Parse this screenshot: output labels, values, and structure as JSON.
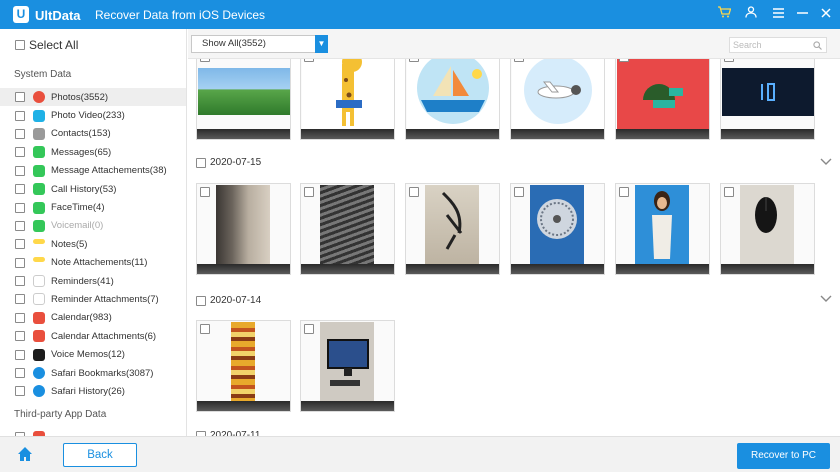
{
  "titlebar": {
    "logo_glyph": "U",
    "app_name": "UltData",
    "subtitle": "Recover Data from iOS Devices",
    "icons": [
      "cart-icon",
      "user-icon",
      "menu-icon",
      "minimize-icon",
      "close-icon"
    ],
    "accent": "#1a8fe0"
  },
  "sidebar": {
    "select_all": "Select All",
    "system_header": "System Data",
    "third_party_header": "Third-party App Data",
    "items": [
      {
        "label": "Photos(3552)",
        "icon": "photos-icon",
        "color": "#e94f3d",
        "checked": false,
        "selected": true,
        "disabled": false
      },
      {
        "label": "Photo Video(233)",
        "icon": "photo-video-icon",
        "color": "#1fb1e6",
        "checked": false,
        "selected": false,
        "disabled": false
      },
      {
        "label": "Contacts(153)",
        "icon": "contacts-icon",
        "color": "#9a9a9a",
        "checked": false,
        "selected": false,
        "disabled": false
      },
      {
        "label": "Messages(65)",
        "icon": "messages-icon",
        "color": "#34c759",
        "checked": false,
        "selected": false,
        "disabled": false
      },
      {
        "label": "Message Attachements(38)",
        "icon": "message-attachments-icon",
        "color": "#34c759",
        "checked": false,
        "selected": false,
        "disabled": false
      },
      {
        "label": "Call History(53)",
        "icon": "call-history-icon",
        "color": "#34c759",
        "checked": false,
        "selected": false,
        "disabled": false
      },
      {
        "label": "FaceTime(4)",
        "icon": "facetime-icon",
        "color": "#34c759",
        "checked": false,
        "selected": false,
        "disabled": false
      },
      {
        "label": "Voicemail(0)",
        "icon": "voicemail-icon",
        "color": "#34c759",
        "checked": false,
        "selected": false,
        "disabled": true
      },
      {
        "label": "Notes(5)",
        "icon": "notes-icon",
        "color": "#ffd84a",
        "checked": false,
        "selected": false,
        "disabled": false
      },
      {
        "label": "Note Attachements(11)",
        "icon": "note-attachments-icon",
        "color": "#ffd84a",
        "checked": false,
        "selected": false,
        "disabled": false
      },
      {
        "label": "Reminders(41)",
        "icon": "reminders-icon",
        "color": "#ffffff",
        "checked": false,
        "selected": false,
        "disabled": false
      },
      {
        "label": "Reminder Attachments(7)",
        "icon": "reminder-attachments-icon",
        "color": "#ffffff",
        "checked": false,
        "selected": false,
        "disabled": false
      },
      {
        "label": "Calendar(983)",
        "icon": "calendar-icon",
        "color": "#e94f3d",
        "checked": false,
        "selected": false,
        "disabled": false
      },
      {
        "label": "Calendar Attachments(6)",
        "icon": "calendar-attachments-icon",
        "color": "#e94f3d",
        "checked": false,
        "selected": false,
        "disabled": false
      },
      {
        "label": "Voice Memos(12)",
        "icon": "voice-memos-icon",
        "color": "#1c1c1c",
        "checked": false,
        "selected": false,
        "disabled": false
      },
      {
        "label": "Safari Bookmarks(3087)",
        "icon": "safari-bookmarks-icon",
        "color": "#1a8fe0",
        "checked": false,
        "selected": false,
        "disabled": false
      },
      {
        "label": "Safari History(26)",
        "icon": "safari-history-icon",
        "color": "#1a8fe0",
        "checked": false,
        "selected": false,
        "disabled": false
      }
    ]
  },
  "toolbar": {
    "filter_value": "Show All(3552)",
    "search_placeholder": "Search"
  },
  "content": {
    "groups": [
      {
        "date": "",
        "photos": [
          "meadow",
          "giraffe",
          "sailboat",
          "airplane",
          "red-character",
          "dark-screen"
        ]
      },
      {
        "date": "2020-07-15",
        "photos": [
          "wall",
          "fan",
          "cable",
          "fan-grill",
          "woman-poster",
          "mouse"
        ]
      },
      {
        "date": "2020-07-14",
        "photos": [
          "food-collage",
          "desk-monitor"
        ]
      },
      {
        "date": "2020-07-11",
        "photos": []
      }
    ]
  },
  "bottombar": {
    "back_label": "Back",
    "recover_label": "Recover to PC"
  }
}
